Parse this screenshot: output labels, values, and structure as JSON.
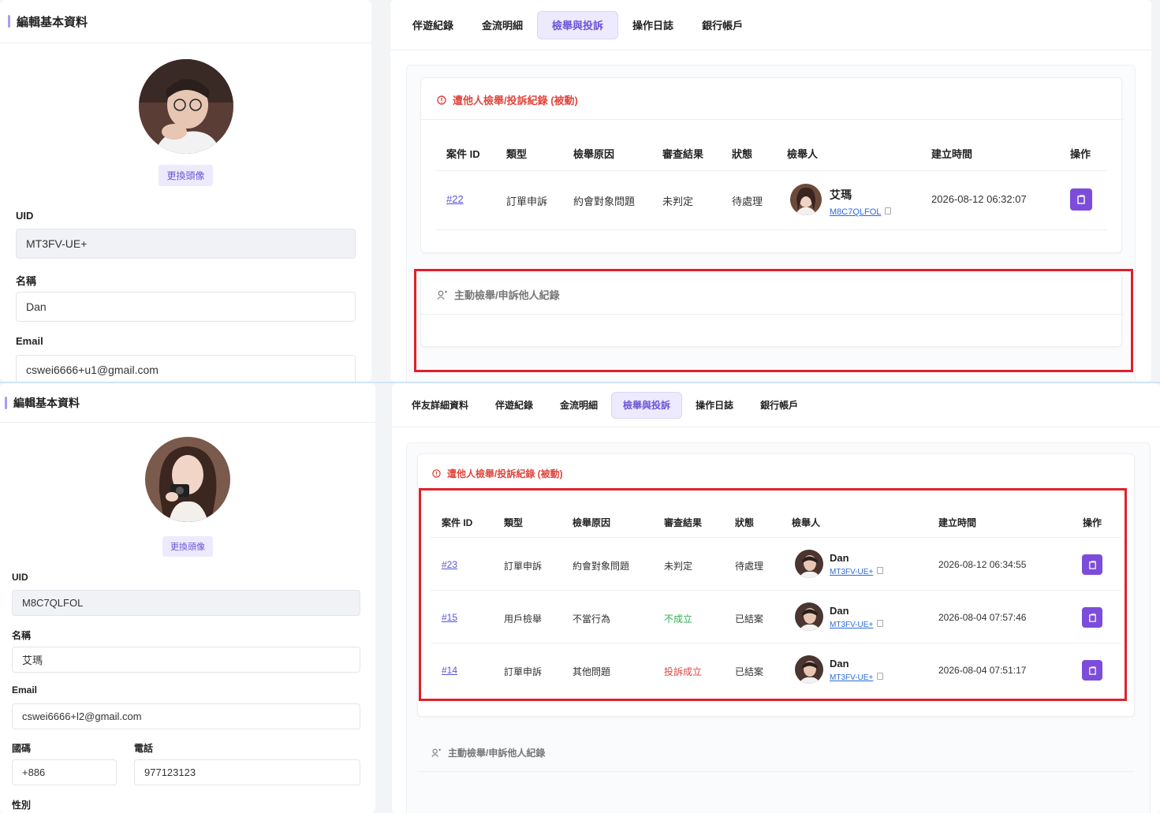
{
  "top": {
    "left": {
      "title": "編輯基本資料",
      "change_avatar": "更換頭像",
      "uid_label": "UID",
      "uid_value": "MT3FV-UE+",
      "name_label": "名稱",
      "name_value": "Dan",
      "email_label": "Email",
      "email_value": "cswei6666+u1@gmail.com"
    },
    "tabs": [
      "伴遊紀錄",
      "金流明細",
      "檢舉與投訴",
      "操作日誌",
      "銀行帳戶"
    ],
    "active_tab": "檢舉與投訴",
    "passive_title": "遭他人檢舉/投訴紀錄 (被動)",
    "headers": [
      "案件 ID",
      "類型",
      "檢舉原因",
      "審查結果",
      "狀態",
      "檢舉人",
      "建立時間",
      "操作"
    ],
    "rows": [
      {
        "id": "#22",
        "type": "訂單申訴",
        "reason": "約會對象問題",
        "result": "未判定",
        "status": "待處理",
        "reporter_name": "艾瑪",
        "reporter_uid": "M8C7QLFOL",
        "time": "2026-08-12 06:32:07"
      }
    ],
    "active_title": "主動檢舉/申訴他人紀錄"
  },
  "bottom": {
    "left": {
      "title": "編輯基本資料",
      "change_avatar": "更換頭像",
      "uid_label": "UID",
      "uid_value": "M8C7QLFOL",
      "name_label": "名稱",
      "name_value": "艾瑪",
      "email_label": "Email",
      "email_value": "cswei6666+l2@gmail.com",
      "country_label": "國碼",
      "country_value": "+886",
      "phone_label": "電話",
      "phone_value": "977123123",
      "gender_label": "性別"
    },
    "tabs": [
      "伴友詳細資料",
      "伴遊紀錄",
      "金流明細",
      "檢舉與投訴",
      "操作日誌",
      "銀行帳戶"
    ],
    "active_tab": "檢舉與投訴",
    "passive_title": "遭他人檢舉/投訴紀錄 (被動)",
    "headers": [
      "案件 ID",
      "類型",
      "檢舉原因",
      "審查結果",
      "狀態",
      "檢舉人",
      "建立時間",
      "操作"
    ],
    "rows": [
      {
        "id": "#23",
        "type": "訂單申訴",
        "reason": "約會對象問題",
        "result": "未判定",
        "result_color": "#333333",
        "status": "待處理",
        "reporter_name": "Dan",
        "reporter_uid": "MT3FV-UE+",
        "time": "2026-08-12 06:34:55"
      },
      {
        "id": "#15",
        "type": "用戶檢舉",
        "reason": "不當行為",
        "result": "不成立",
        "result_color": "#2fae4e",
        "status": "已結案",
        "reporter_name": "Dan",
        "reporter_uid": "MT3FV-UE+",
        "time": "2026-08-04 07:57:46"
      },
      {
        "id": "#14",
        "type": "訂單申訴",
        "reason": "其他問題",
        "result": "投訴成立",
        "result_color": "#e0463e",
        "status": "已結案",
        "reporter_name": "Dan",
        "reporter_uid": "MT3FV-UE+",
        "time": "2026-08-04 07:51:17"
      }
    ],
    "active_title": "主動檢舉/申訴他人紀錄"
  },
  "colors": {
    "accent": "#7c4ddb",
    "highlight": "#e0202a",
    "danger": "#e0463e",
    "success": "#2fae4e"
  }
}
